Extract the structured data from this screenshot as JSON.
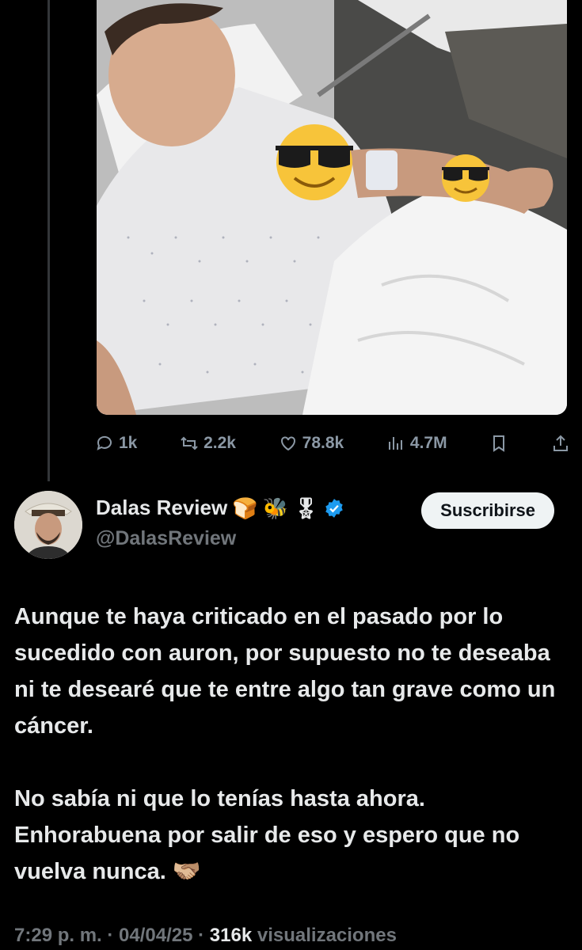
{
  "media": {
    "icons": [
      "sunglasses-emoji",
      "sunglasses-emoji"
    ]
  },
  "actions": {
    "replies": "1k",
    "reposts": "2.2k",
    "likes": "78.8k",
    "views": "4.7M"
  },
  "author": {
    "name": "Dalas Review",
    "emojis": [
      "🍞",
      "🐝",
      "🎖"
    ],
    "handle": "@DalasReview",
    "subscribe_label": "Suscribirse",
    "verified_color": "#1d9bf0"
  },
  "tweet": {
    "paragraph_1": "Aunque te haya criticado en el pasado por lo sucedido con auron, por supuesto no te deseaba ni te desearé que te entre algo tan grave como un cáncer.",
    "paragraph_2": "No sabía ni que lo tenías hasta ahora. Enhorabuena por salir de eso y espero que no vuelva nunca. 🫱🏼‍🫲🏽"
  },
  "meta": {
    "time": "7:29 p. m.",
    "date": "04/04/25",
    "views_count": "316k",
    "views_label": "visualizaciones"
  }
}
